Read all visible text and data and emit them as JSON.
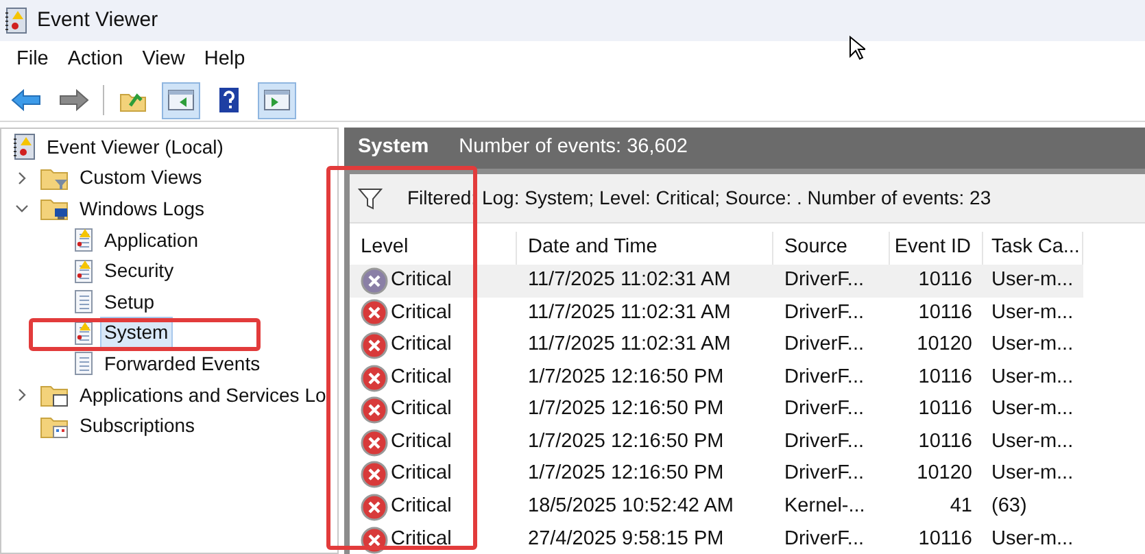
{
  "window": {
    "title": "Event Viewer"
  },
  "menu": [
    "File",
    "Action",
    "View",
    "Help"
  ],
  "toolbar": [
    {
      "kind": "back",
      "selected": false
    },
    {
      "kind": "forward",
      "selected": false
    },
    {
      "kind": "up",
      "selected": false
    },
    {
      "kind": "pane",
      "selected": true
    },
    {
      "kind": "help",
      "selected": false
    },
    {
      "kind": "pane2",
      "selected": true
    }
  ],
  "tree": [
    {
      "label": "Event Viewer (Local)",
      "kind": "root",
      "selected": false,
      "children": [
        {
          "label": "Custom Views",
          "kind": "folder",
          "expanded": false,
          "selected": false
        },
        {
          "label": "Windows Logs",
          "kind": "folder",
          "expanded": true,
          "selected": false,
          "children": [
            {
              "label": "Application",
              "kind": "alertlog",
              "selected": false
            },
            {
              "label": "Security",
              "kind": "alertlog",
              "selected": false
            },
            {
              "label": "Setup",
              "kind": "log",
              "selected": false
            },
            {
              "label": "System",
              "kind": "alertlog",
              "selected": true
            },
            {
              "label": "Forwarded Events",
              "kind": "log",
              "selected": false
            }
          ]
        },
        {
          "label": "Applications and Services Lo",
          "kind": "folder",
          "expanded": false,
          "selected": false
        },
        {
          "label": "Subscriptions",
          "kind": "folder",
          "selected": false
        }
      ]
    }
  ],
  "pane_header": {
    "title": "System",
    "count": "Number of events: 36,602"
  },
  "filter": "Filtered: Log: System; Level: Critical; Source: . Number of events: 23",
  "table": {
    "columns": [
      "Level",
      "Date and Time",
      "Source",
      "Event ID",
      "Task Ca..."
    ],
    "rows": [
      {
        "selected": true,
        "cells": [
          "Critical",
          "11/7/2025 11:02:31 AM",
          "DriverF...",
          "10116",
          "User-m..."
        ]
      },
      {
        "selected": false,
        "cells": [
          "Critical",
          "11/7/2025 11:02:31 AM",
          "DriverF...",
          "10116",
          "User-m..."
        ]
      },
      {
        "selected": false,
        "cells": [
          "Critical",
          "11/7/2025 11:02:31 AM",
          "DriverF...",
          "10120",
          "User-m..."
        ]
      },
      {
        "selected": false,
        "cells": [
          "Critical",
          "1/7/2025 12:16:50 PM",
          "DriverF...",
          "10116",
          "User-m..."
        ]
      },
      {
        "selected": false,
        "cells": [
          "Critical",
          "1/7/2025 12:16:50 PM",
          "DriverF...",
          "10116",
          "User-m..."
        ]
      },
      {
        "selected": false,
        "cells": [
          "Critical",
          "1/7/2025 12:16:50 PM",
          "DriverF...",
          "10116",
          "User-m..."
        ]
      },
      {
        "selected": false,
        "cells": [
          "Critical",
          "1/7/2025 12:16:50 PM",
          "DriverF...",
          "10120",
          "User-m..."
        ]
      },
      {
        "selected": false,
        "cells": [
          "Critical",
          "18/5/2025 10:52:42 AM",
          "Kernel-...",
          "41",
          "(63)"
        ]
      },
      {
        "selected": false,
        "cells": [
          "Critical",
          "27/4/2025 9:58:15 PM",
          "DriverF...",
          "10116",
          "User-m..."
        ]
      }
    ]
  }
}
